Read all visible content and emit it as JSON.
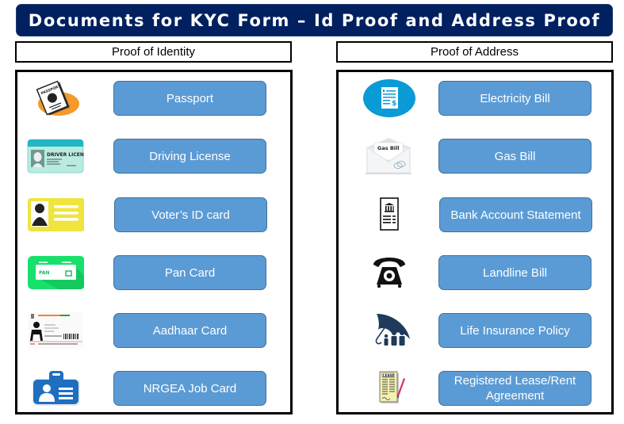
{
  "title": "Documents for KYC Form – Id Proof and Address Proof",
  "colors": {
    "banner_bg": "#002060",
    "button_fill": "#5b9bd5",
    "button_border": "#41719c"
  },
  "identity": {
    "header": "Proof of Identity",
    "items": [
      {
        "label": "Passport",
        "icon": "passport-icon"
      },
      {
        "label": "Driving License",
        "icon": "driving-license-icon"
      },
      {
        "label": "Voter’s ID card",
        "icon": "voter-id-icon"
      },
      {
        "label": "Pan Card",
        "icon": "pan-card-icon"
      },
      {
        "label": "Aadhaar Card",
        "icon": "aadhaar-card-icon"
      },
      {
        "label": "NRGEA Job Card",
        "icon": "id-badge-icon"
      }
    ]
  },
  "address": {
    "header": "Proof of Address",
    "items": [
      {
        "label": "Electricity Bill",
        "icon": "electricity-bill-icon"
      },
      {
        "label": "Gas Bill",
        "icon": "gas-bill-envelope-icon",
        "icon_text": "Gas Bill"
      },
      {
        "label": "Bank Account Statement",
        "icon": "bank-statement-icon"
      },
      {
        "label": "Landline Bill",
        "icon": "telephone-icon"
      },
      {
        "label": "Life Insurance Policy",
        "icon": "umbrella-family-icon"
      },
      {
        "label": "Registered Lease/Rent Agreement",
        "icon": "lease-document-icon",
        "icon_text": "LEASE"
      }
    ]
  },
  "icon_texts": {
    "passport": "PASSPORT",
    "driver_license": "DRIVER LICENSE",
    "pan": "PAN"
  }
}
